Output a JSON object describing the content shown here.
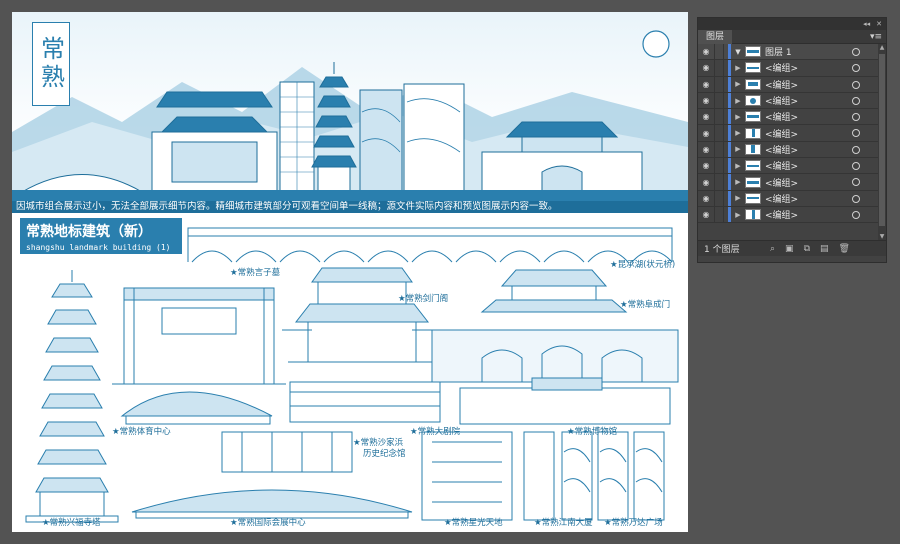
{
  "artboard": {
    "title_vertical": "常熟",
    "notice": "因城市组合展示过小，无法全部展示细节内容。精细城市建筑部分可观看空间单一线稿；源文件实际内容和预览图展示内容一致。",
    "section_label_cn": "常熟地标建筑（新）",
    "section_label_en": "shangshu landmark building (1)",
    "captions": {
      "yanzi": "★常熟言子墓",
      "zhuangyuan": "★昆承湖(状元桥)",
      "jianmen": "★常熟剑门阁",
      "fucheng": "★常熟阜成门",
      "tiyu": "★常熟体育中心",
      "daju": "★常熟大剧院",
      "bowu": "★常熟博物馆",
      "shajia": "★常熟沙家浜",
      "shajia2": "历史纪念馆",
      "xingfu": "★常熟兴福寺塔",
      "huizhan": "★常熟国际会展中心",
      "xingguang": "★常熟星光天地",
      "jiangnan": "★常熟江南大厦",
      "wanda": "★常熟万达广场"
    },
    "colors": {
      "line": "#2a7fae",
      "dark": "#1e6e9a",
      "light": "#cde4f1"
    }
  },
  "layers_panel": {
    "tab": "图层",
    "footer_count": "1 个图层",
    "layers": [
      {
        "name": "图层 1",
        "expanded": true,
        "top": true,
        "icon": "folder-icon"
      },
      {
        "name": "<编组>",
        "icon": "group-thumb"
      },
      {
        "name": "<编组>",
        "icon": "group-thumb"
      },
      {
        "name": "<编组>",
        "icon": "group-thumb"
      },
      {
        "name": "<编组>",
        "icon": "group-thumb"
      },
      {
        "name": "<编组>",
        "icon": "group-thumb"
      },
      {
        "name": "<编组>",
        "icon": "group-thumb"
      },
      {
        "name": "<编组>",
        "icon": "group-thumb"
      },
      {
        "name": "<编组>",
        "icon": "group-thumb"
      },
      {
        "name": "<编组>",
        "icon": "group-thumb"
      },
      {
        "name": "<编组>",
        "icon": "group-thumb"
      }
    ]
  }
}
